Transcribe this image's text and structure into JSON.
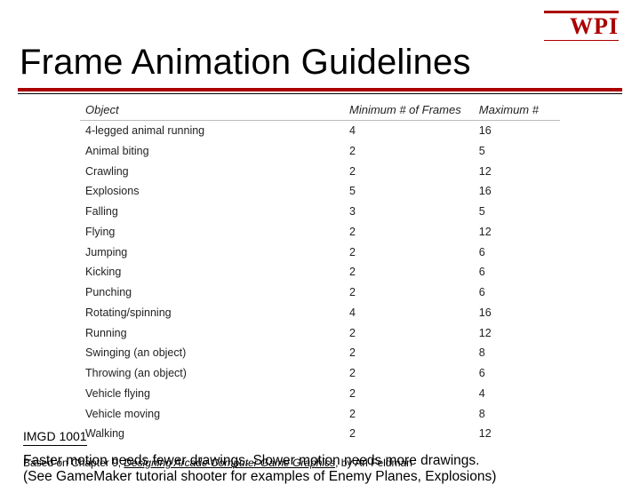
{
  "logo": {
    "text": "WPI"
  },
  "title": "Frame Animation Guidelines",
  "chart_data": {
    "type": "table",
    "columns": [
      "Object",
      "Minimum # of Frames",
      "Maximum #"
    ],
    "rows": [
      {
        "obj": "4-legged animal running",
        "min": "4",
        "max": "16"
      },
      {
        "obj": "Animal biting",
        "min": "2",
        "max": "5"
      },
      {
        "obj": "Crawling",
        "min": "2",
        "max": "12"
      },
      {
        "obj": "Explosions",
        "min": "5",
        "max": "16"
      },
      {
        "obj": "Falling",
        "min": "3",
        "max": "5"
      },
      {
        "obj": "Flying",
        "min": "2",
        "max": "12"
      },
      {
        "obj": "Jumping",
        "min": "2",
        "max": "6"
      },
      {
        "obj": "Kicking",
        "min": "2",
        "max": "6"
      },
      {
        "obj": "Punching",
        "min": "2",
        "max": "6"
      },
      {
        "obj": "Rotating/spinning",
        "min": "4",
        "max": "16"
      },
      {
        "obj": "Running",
        "min": "2",
        "max": "12"
      },
      {
        "obj": "Swinging (an object)",
        "min": "2",
        "max": "8"
      },
      {
        "obj": "Throwing (an object)",
        "min": "2",
        "max": "6"
      },
      {
        "obj": "Vehicle flying",
        "min": "2",
        "max": "4"
      },
      {
        "obj": "Vehicle moving",
        "min": "2",
        "max": "8"
      },
      {
        "obj": "Walking",
        "min": "2",
        "max": "12"
      }
    ]
  },
  "notes": {
    "line1": "Faster motion needs fewer drawings.  Slower motion needs more drawings.",
    "line2": "(See GameMaker tutorial shooter for examples of Enemy Planes, Explosions)"
  },
  "course": "IMGD 1001",
  "footer": {
    "prefix": "Based on Chapter 9, ",
    "book": "Designing Arcade Computer Game Graphics",
    "suffix": ", by Ari Feldman"
  }
}
